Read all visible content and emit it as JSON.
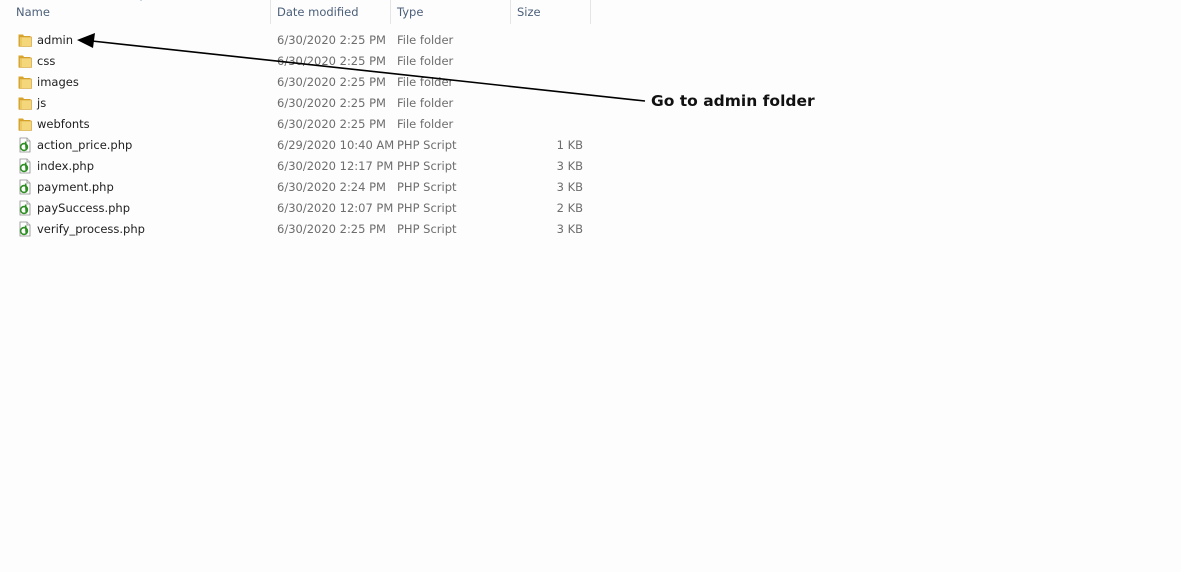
{
  "columns": {
    "name": "Name",
    "date_modified": "Date modified",
    "type": "Type",
    "size": "Size"
  },
  "files": [
    {
      "name": "admin",
      "date": "6/30/2020 2:25 PM",
      "type": "File folder",
      "size": "",
      "icon": "folder-icon"
    },
    {
      "name": "css",
      "date": "6/30/2020 2:25 PM",
      "type": "File folder",
      "size": "",
      "icon": "folder-icon"
    },
    {
      "name": "images",
      "date": "6/30/2020 2:25 PM",
      "type": "File folder",
      "size": "",
      "icon": "folder-icon"
    },
    {
      "name": "js",
      "date": "6/30/2020 2:25 PM",
      "type": "File folder",
      "size": "",
      "icon": "folder-icon"
    },
    {
      "name": "webfonts",
      "date": "6/30/2020 2:25 PM",
      "type": "File folder",
      "size": "",
      "icon": "folder-icon"
    },
    {
      "name": "action_price.php",
      "date": "6/29/2020 10:40 AM",
      "type": "PHP Script",
      "size": "1 KB",
      "icon": "php-file-icon"
    },
    {
      "name": "index.php",
      "date": "6/30/2020 12:17 PM",
      "type": "PHP Script",
      "size": "3 KB",
      "icon": "php-file-icon"
    },
    {
      "name": "payment.php",
      "date": "6/30/2020 2:24 PM",
      "type": "PHP Script",
      "size": "3 KB",
      "icon": "php-file-icon"
    },
    {
      "name": "paySuccess.php",
      "date": "6/30/2020 12:07 PM",
      "type": "PHP Script",
      "size": "2 KB",
      "icon": "php-file-icon"
    },
    {
      "name": "verify_process.php",
      "date": "6/30/2020 2:25 PM",
      "type": "PHP Script",
      "size": "3 KB",
      "icon": "php-file-icon"
    }
  ],
  "annotation": {
    "label": "Go to admin folder"
  },
  "colors": {
    "header_text": "#4c607a",
    "meta_text": "#6d6d6d",
    "folder": "#e8c24f",
    "php_icon": "#3c9a2e"
  }
}
